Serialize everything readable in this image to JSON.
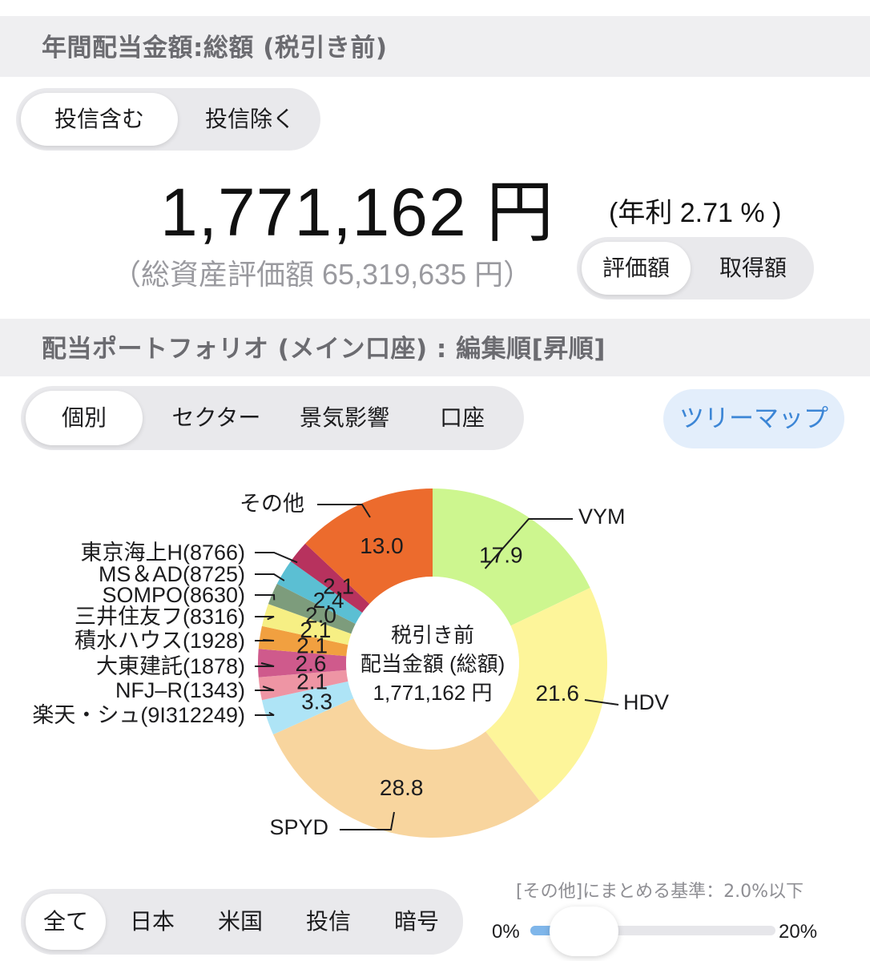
{
  "header1": {
    "title": "年間配当金額:総額 (税引き前)"
  },
  "fund_toggle": {
    "options": [
      "投信含む",
      "投信除く"
    ],
    "selected": 0
  },
  "summary": {
    "amount": "1,771,162 円",
    "yield": "(年利 2.71 % )",
    "total_assets": "（総資産評価額 65,319,635 円）"
  },
  "basis_toggle": {
    "options": [
      "評価額",
      "取得額"
    ],
    "selected": 0
  },
  "header2": {
    "title": "配当ポートフォリオ (メイン口座) : 編集順[昇順]"
  },
  "view_tabs": {
    "options": [
      "個別",
      "セクター",
      "景気影響",
      "口座"
    ],
    "selected": 0
  },
  "treemap_button": "ツリーマップ",
  "chart_data": {
    "type": "pie",
    "center_text": [
      "税引き前",
      "配当金額 (総額)",
      "1,771,162 円"
    ],
    "slices": [
      {
        "label": "VYM",
        "value": 17.9,
        "value_label": "17.9",
        "color": "#cdf68f"
      },
      {
        "label": "HDV",
        "value": 21.6,
        "value_label": "21.6",
        "color": "#fdf59a"
      },
      {
        "label": "SPYD",
        "value": 28.8,
        "value_label": "28.8",
        "color": "#f8d59e"
      },
      {
        "label": "楽天・シュ(9I312249)",
        "value": 3.3,
        "value_label": "3.3",
        "color": "#aee4f6"
      },
      {
        "label": "NFJ–R(1343)",
        "value": 2.1,
        "value_label": "2.1",
        "color": "#ee95a4"
      },
      {
        "label": "大東建託(1878)",
        "value": 2.6,
        "value_label": "2.6",
        "color": "#cf5a8c"
      },
      {
        "label": "積水ハウス(1928)",
        "value": 2.1,
        "value_label": "2.1",
        "color": "#f1a040"
      },
      {
        "label": "三井住友フ(8316)",
        "value": 2.1,
        "value_label": "2.1",
        "color": "#f6ef84"
      },
      {
        "label": "SOMPO(8630)",
        "value": 2.0,
        "value_label": "2.0",
        "color": "#7d9c7c"
      },
      {
        "label": "MS＆AD(8725)",
        "value": 2.4,
        "value_label": "2.4",
        "color": "#5bbfd3"
      },
      {
        "label": "東京海上H(8766)",
        "value": 2.1,
        "value_label": "2.1",
        "color": "#b7325e"
      },
      {
        "label": "その他",
        "value": 13.0,
        "value_label": "13.0",
        "color": "#ec6b2d"
      }
    ]
  },
  "region_tabs": {
    "options": [
      "全て",
      "日本",
      "米国",
      "投信",
      "暗号"
    ],
    "selected": 0
  },
  "slider": {
    "caption": "[その他]にまとめる基準：2.0%以下",
    "min_label": "0%",
    "max_label": "20%",
    "value": 2.0,
    "max": 20
  }
}
